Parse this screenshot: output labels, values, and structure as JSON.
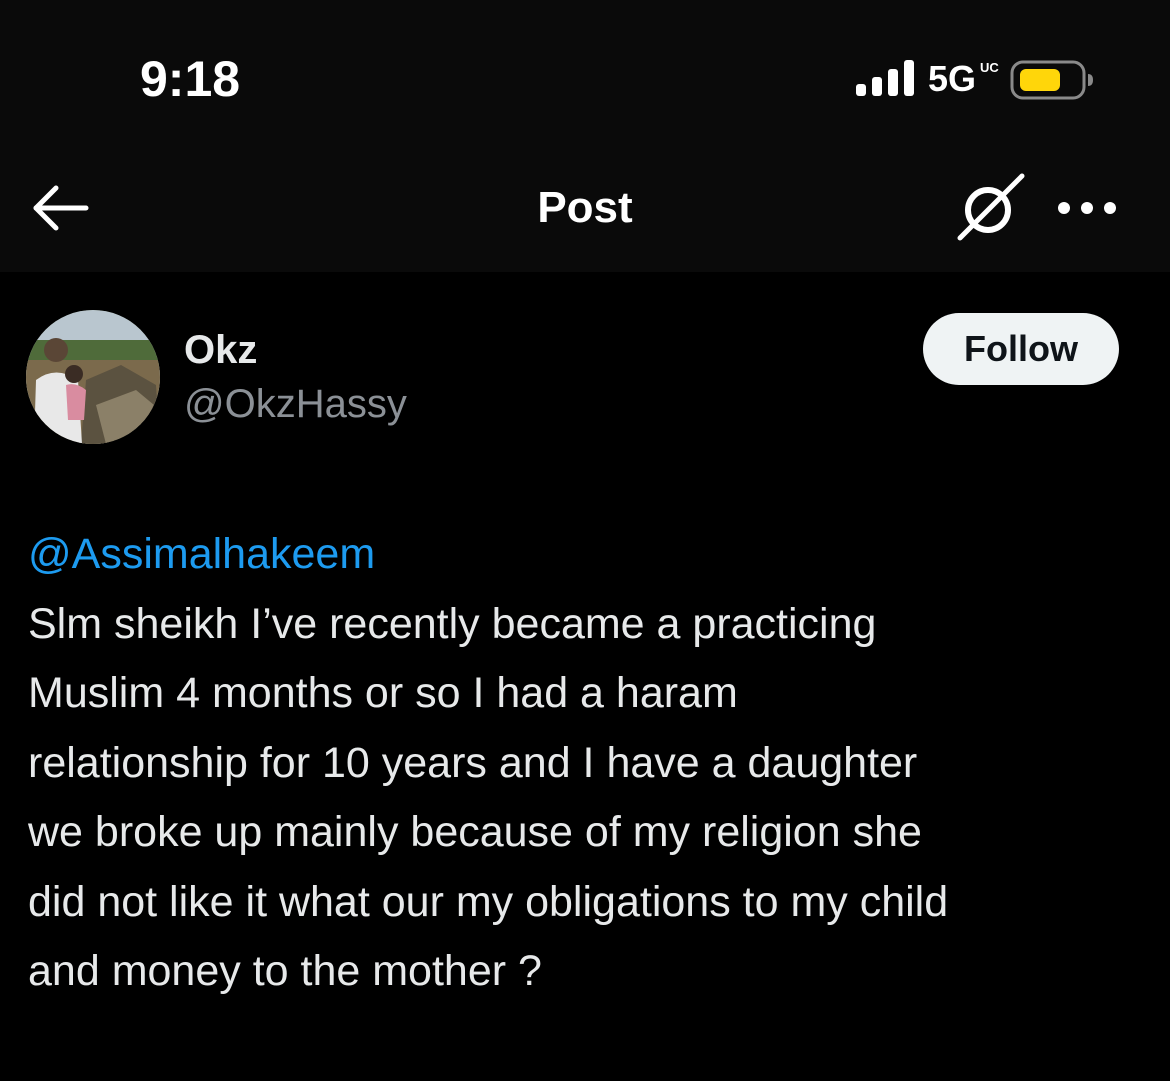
{
  "status_bar": {
    "time": "9:18",
    "network": "5G",
    "network_sub": "UC",
    "battery_color": "#ffd60a"
  },
  "nav": {
    "back_icon": "back-arrow-icon",
    "title": "Post",
    "grok_icon": "grok-icon",
    "more_icon": "more-dots-icon"
  },
  "post": {
    "author_name": "Okz",
    "author_handle": "@OkzHassy",
    "follow_label": "Follow",
    "mention": "@Assimalhakeem",
    "text": " Slm sheikh I’ve recently became a practicing\nMuslim 4 months or so I had a haram\nrelationship for 10 years and I have a daughter\nwe broke up mainly because of my religion she\ndid not like it what our my obligations to my child\nand money  to the mother ?"
  },
  "colors": {
    "background": "#000000",
    "header_background": "#0a0a0a",
    "link": "#1d9bf0",
    "text": "#e7e9ea",
    "secondary_text": "#8b9096",
    "follow_bg": "#eff3f4"
  }
}
